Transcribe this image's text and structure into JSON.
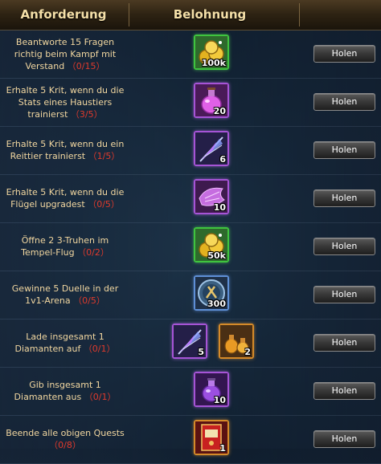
{
  "header": {
    "col_requirement": "Anforderung",
    "col_reward": "Belohnung"
  },
  "colors": {
    "header_text": "#f4dfa8",
    "progress_red": "#e03a2c",
    "req_text": "#f2d7a0"
  },
  "rows": [
    {
      "req_text": "Beantworte 15 Fragen richtig beim Kampf mit Verstand",
      "progress": "（0/15）",
      "button": "Holen",
      "rewards": [
        {
          "icon": "gold-coins-icon",
          "qty": "100k"
        }
      ]
    },
    {
      "req_text": "Erhalte 5 Krit, wenn du die Stats eines Haustiers trainierst",
      "progress": "（3/5）",
      "button": "Holen",
      "rewards": [
        {
          "icon": "pink-potion-icon",
          "qty": "20"
        }
      ]
    },
    {
      "req_text": "Erhalte 5 Krit, wenn du ein Reittier trainierst",
      "progress": "（1/5）",
      "button": "Holen",
      "rewards": [
        {
          "icon": "feather-icon",
          "qty": "6"
        }
      ]
    },
    {
      "req_text": "Erhalte 5 Krit, wenn du die Flügel upgradest",
      "progress": "（0/5）",
      "button": "Holen",
      "rewards": [
        {
          "icon": "wing-crystal-icon",
          "qty": "10"
        }
      ]
    },
    {
      "req_text": "Öffne 2 3-Truhen im Tempel-Flug",
      "progress": "（0/2）",
      "button": "Holen",
      "rewards": [
        {
          "icon": "gold-coins-icon",
          "qty": "50k"
        }
      ]
    },
    {
      "req_text": "Gewinne 5 Duelle in der 1v1-Arena",
      "progress": "（0/5）",
      "button": "Holen",
      "rewards": [
        {
          "icon": "arena-medal-icon",
          "qty": "300"
        }
      ]
    },
    {
      "req_text": "Lade insgesamt 1 Diamanten auf",
      "progress": "（0/1）",
      "button": "Holen",
      "rewards": [
        {
          "icon": "feather-icon",
          "qty": "5"
        },
        {
          "icon": "gold-potion-icon",
          "qty": "2"
        }
      ]
    },
    {
      "req_text": "Gib insgesamt 1 Diamanten aus",
      "progress": "（0/1）",
      "button": "Holen",
      "rewards": [
        {
          "icon": "purple-potion-icon",
          "qty": "10"
        }
      ]
    },
    {
      "req_text": "Beende alle obigen Quests",
      "progress": "（0/8）",
      "button": "Holen",
      "rewards": [
        {
          "icon": "red-book-icon",
          "qty": "1"
        }
      ]
    }
  ]
}
